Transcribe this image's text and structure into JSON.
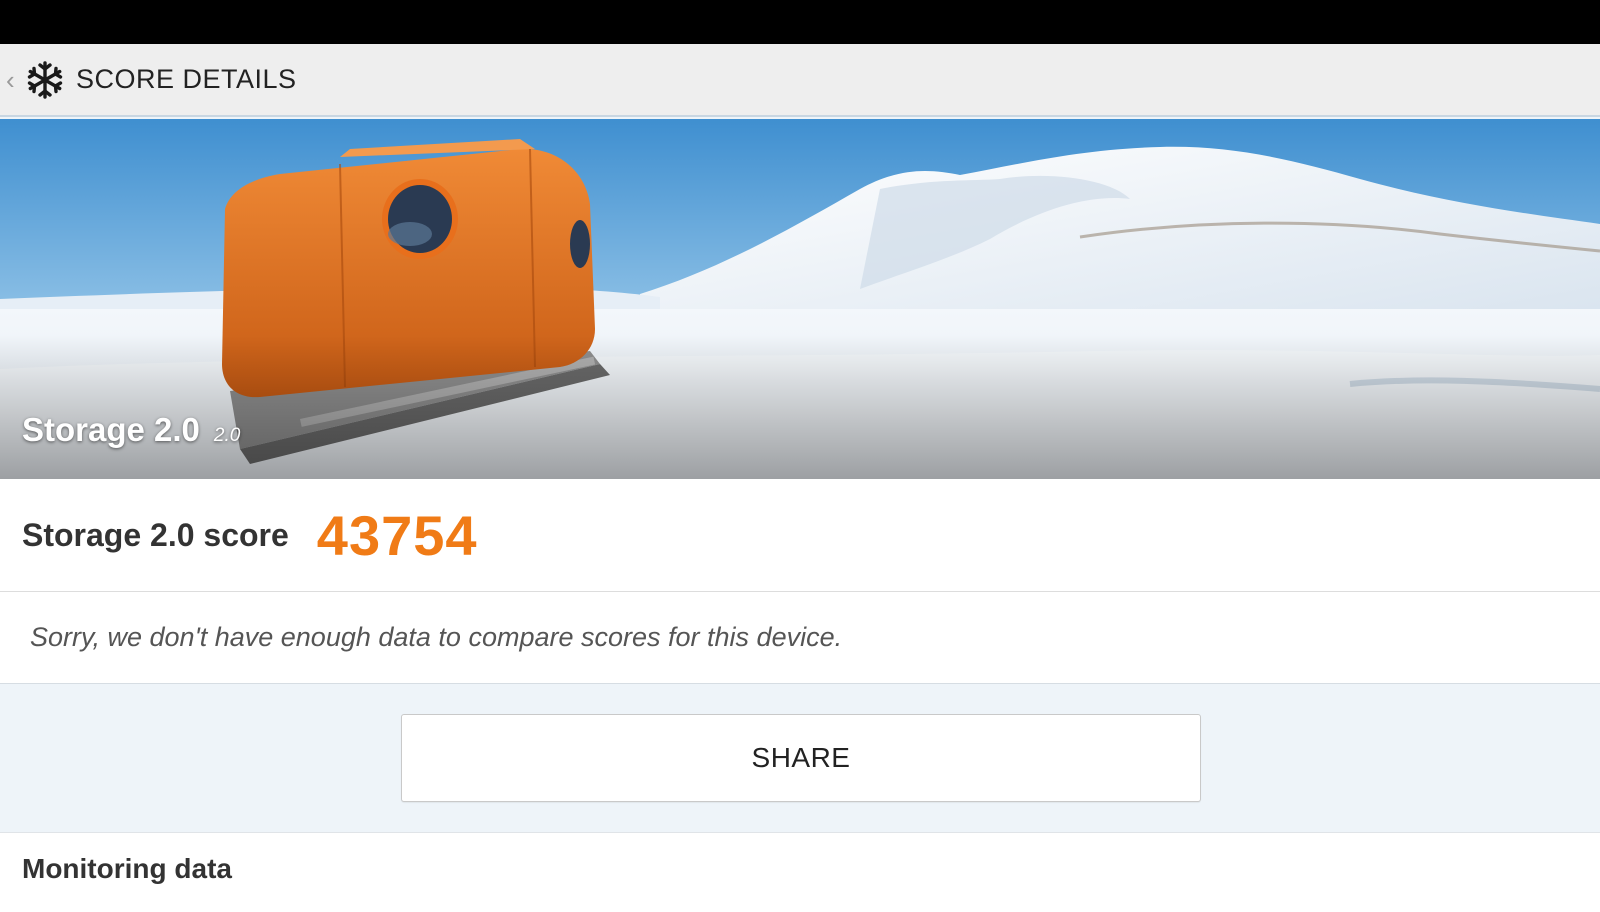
{
  "action_bar": {
    "back_icon": "chevron-left-icon",
    "app_icon": "snowflake-icon",
    "title": "SCORE DETAILS"
  },
  "hero": {
    "test_name": "Storage 2.0",
    "version": "2.0"
  },
  "score": {
    "label": "Storage 2.0 score",
    "value": "43754"
  },
  "compare": {
    "message": "Sorry, we don't have enough data to compare scores for this device."
  },
  "actions": {
    "share_label": "SHARE"
  },
  "monitoring": {
    "title": "Monitoring data"
  },
  "colors": {
    "score_accent": "#f07b16",
    "background": "#eef4f9",
    "status_bar": "#000000",
    "action_bar": "#eeeeee"
  }
}
